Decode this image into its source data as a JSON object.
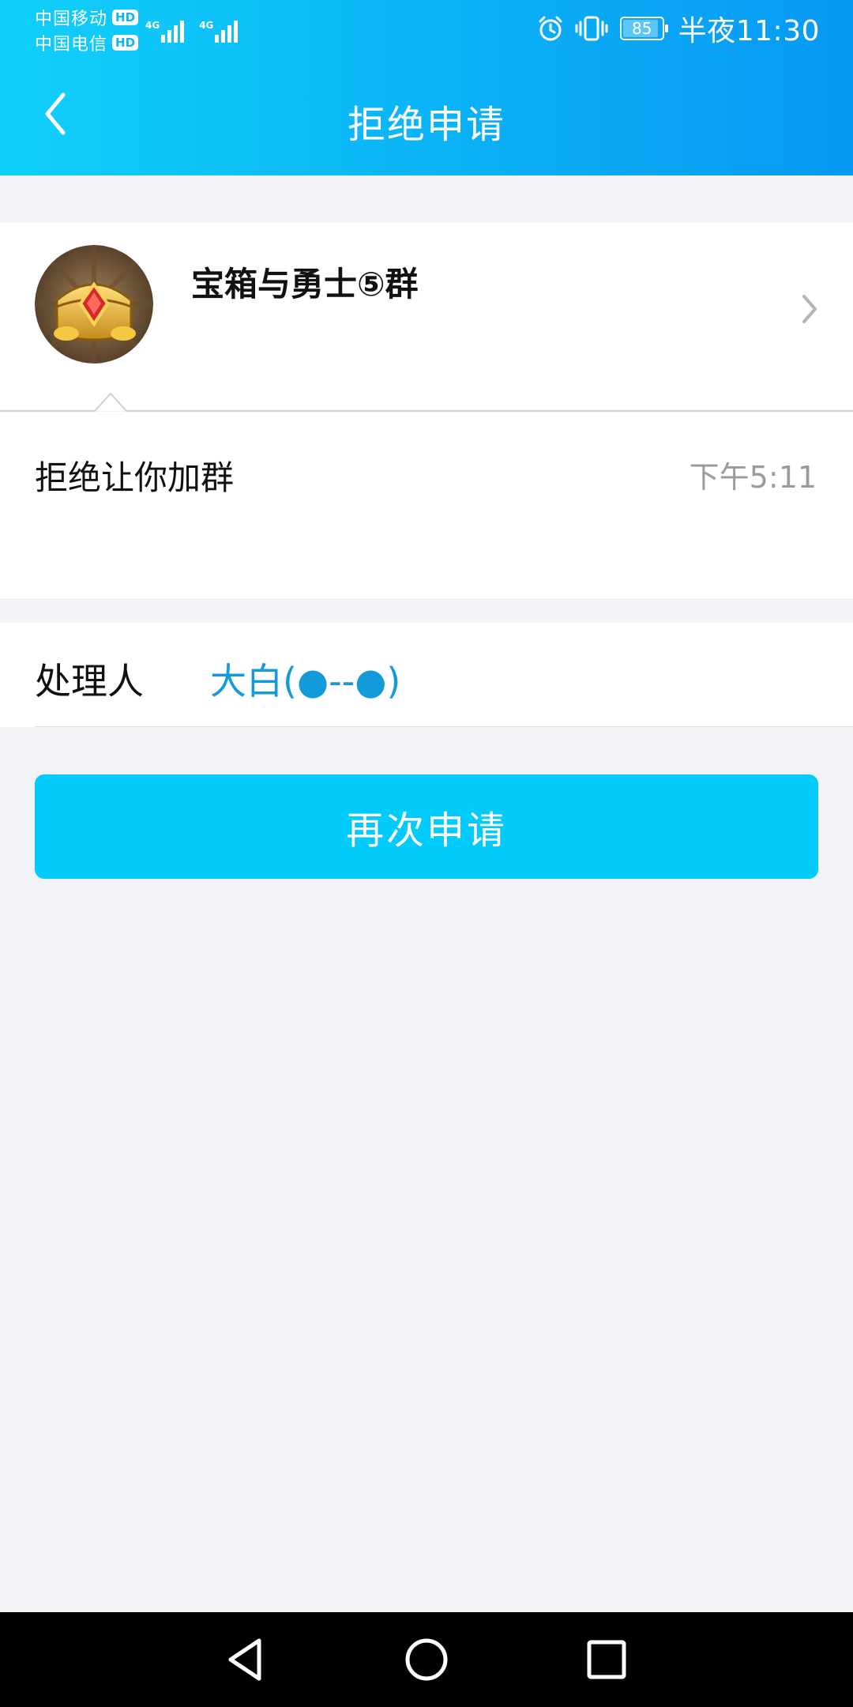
{
  "status_bar": {
    "carrier_1": "中国移动",
    "carrier_2": "中国电信",
    "hd_label": "HD",
    "network_1": "4G",
    "network_2": "4G",
    "battery_level": "85",
    "time": "半夜11:30"
  },
  "header": {
    "title": "拒绝申请",
    "back_icon": "chevron-left-icon",
    "bg_color_start": "#11d0fb",
    "bg_color_end": "#0899f3"
  },
  "group": {
    "name": "宝箱与勇士⑤群",
    "avatar_icon": "treasure-chest-icon"
  },
  "message": {
    "text": "拒绝让你加群",
    "time": "下午5:11"
  },
  "handler": {
    "label": "处理人",
    "name": "大白(●--●)",
    "name_color": "#139ad8"
  },
  "actions": {
    "reapply_label": "再次申请",
    "button_color": "#00cbfa"
  },
  "navigation": {
    "back_icon": "triangle-back-icon",
    "home_icon": "circle-home-icon",
    "recents_icon": "square-recents-icon"
  }
}
